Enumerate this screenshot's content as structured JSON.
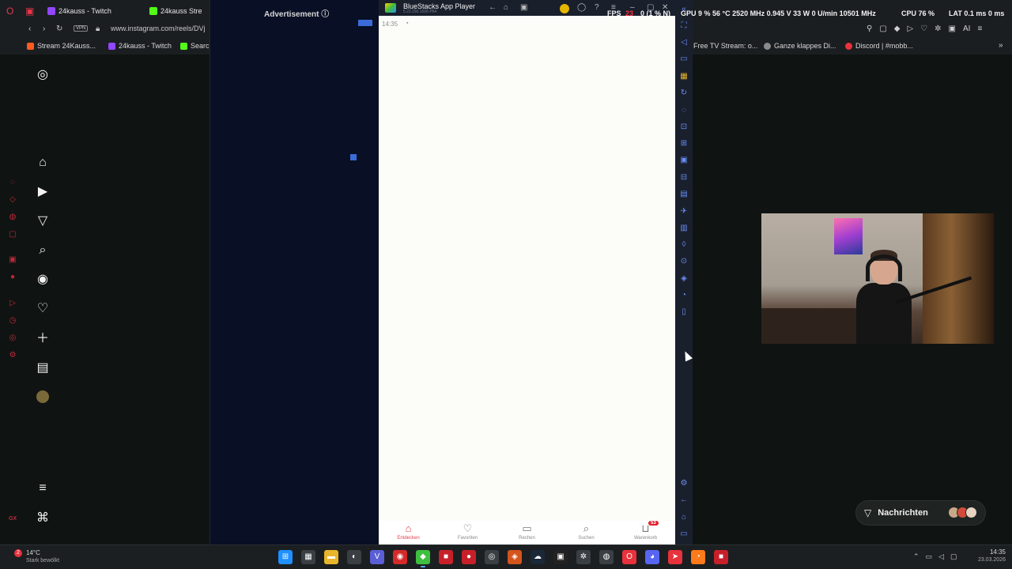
{
  "browser": {
    "tabs": [
      {
        "label": "24kauss - Twitch",
        "color": "#9146ff"
      },
      {
        "label": "24kauss Stre",
        "color": "#53fc18"
      }
    ],
    "url": "www.instagram.com/reels/DVj",
    "vpn_label": "VPN",
    "bookmarks": [
      {
        "label": "Stream 24Kauss...",
        "color": "#ff5a1f"
      },
      {
        "label": "24kauss - Twitch",
        "color": "#9146ff"
      },
      {
        "label": "Searc",
        "color": "#53fc18"
      }
    ],
    "right_bookmarks": [
      {
        "label": "Free TV Stream: o...",
        "color": "#2a7bd8"
      },
      {
        "label": "Ganze klappes Di...",
        "color": "#8a8a8a"
      },
      {
        "label": "Discord | #mobb...",
        "color": "#e8323c"
      }
    ]
  },
  "instagram": {
    "nav_icons": [
      "instagram-logo-icon",
      "home-icon",
      "reels-icon",
      "direct-icon",
      "search-icon",
      "explore-icon",
      "heart-icon",
      "create-icon",
      "dashboard-icon",
      "profile-avatar"
    ],
    "bottom_icons": [
      "menu-icon",
      "threads-icon"
    ]
  },
  "ad": {
    "title": "Advertisement",
    "info_glyph": "ⓘ"
  },
  "bluestacks": {
    "title": "BlueStacks App Player",
    "version": "5.22.150.1026 P64",
    "status_time": "14:35",
    "nav": [
      {
        "label": "Entdecken",
        "icon": "discover-icon",
        "glyph": "⌂",
        "active": true
      },
      {
        "label": "Favoriten",
        "icon": "favorites-icon",
        "glyph": "♡",
        "active": false
      },
      {
        "label": "Rechen",
        "icon": "bag-icon",
        "glyph": "▭",
        "active": false
      },
      {
        "label": "Suchen",
        "icon": "search-icon",
        "glyph": "⌕",
        "active": false
      },
      {
        "label": "Warenkorb",
        "icon": "cart-icon",
        "glyph": "⊔",
        "active": false
      }
    ],
    "cart_badge": "53"
  },
  "metrics": {
    "fps_label": "FPS",
    "fps_value": "23",
    "fps_extra": "0 (1 % N)",
    "gpu": "GPU  9 %  56 °C 2520 MHz  0.945 V  33 W  0 U/min  10501 MHz",
    "cpu": "CPU  76 %",
    "lat": "LAT  0.1 ms  0 ms"
  },
  "messages": {
    "label": "Nachrichten",
    "avatar_colors": [
      "#c9a88a",
      "#d24a3a",
      "#e8d2c0"
    ]
  },
  "taskbar": {
    "weather_temp": "14°C",
    "weather_desc": "Stark bewölkt",
    "weather_badge": "2",
    "time": "14:35",
    "date": "23.03.2026",
    "apps": [
      {
        "name": "windows-start",
        "color": "#1e90ff",
        "glyph": "⊞"
      },
      {
        "name": "calculator",
        "color": "#3a3f44",
        "glyph": "▦"
      },
      {
        "name": "file-explorer",
        "color": "#e8b62c",
        "glyph": "▬"
      },
      {
        "name": "mouse-app",
        "color": "#3a3f44",
        "glyph": "◐"
      },
      {
        "name": "v-app",
        "color": "#5b5fd6",
        "glyph": "V"
      },
      {
        "name": "red-app",
        "color": "#d52a2a",
        "glyph": "◉"
      },
      {
        "name": "bluestacks",
        "color": "#3fbf3f",
        "glyph": "◆",
        "active": true
      },
      {
        "name": "app-red-1",
        "color": "#c8202a",
        "glyph": "■"
      },
      {
        "name": "app-red-2",
        "color": "#c8202a",
        "glyph": "●"
      },
      {
        "name": "app-ring",
        "color": "#3a3f44",
        "glyph": "◎"
      },
      {
        "name": "app-orange",
        "color": "#d4541c",
        "glyph": "◈"
      },
      {
        "name": "steam",
        "color": "#1b2838",
        "glyph": "☁"
      },
      {
        "name": "epic",
        "color": "#222",
        "glyph": "▣"
      },
      {
        "name": "app-gear",
        "color": "#3a3f44",
        "glyph": "✲"
      },
      {
        "name": "chrome",
        "color": "#3a3f44",
        "glyph": "◍"
      },
      {
        "name": "opera",
        "color": "#e8323c",
        "glyph": "O"
      },
      {
        "name": "discord",
        "color": "#5865f2",
        "glyph": "◕"
      },
      {
        "name": "app-bird",
        "color": "#e8323c",
        "glyph": "➤"
      },
      {
        "name": "firefox",
        "color": "#ff7a1a",
        "glyph": "◔"
      },
      {
        "name": "app-red-3",
        "color": "#c8202a",
        "glyph": "■"
      }
    ]
  }
}
